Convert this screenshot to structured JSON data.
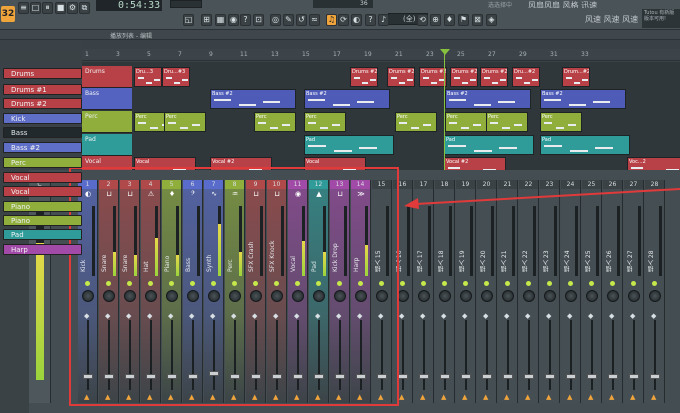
{
  "toolbar": {
    "logo": "32",
    "time": "0:54:33",
    "pattern_name": "Bass",
    "pattern_num": "36",
    "snap": "(全)",
    "top_info": "选选择中",
    "top_info2": "风扇风扇 风格 迅速",
    "big_eq": "风速 风速 风速",
    "tip": "Tutou 有新版\n版本可用!",
    "buttons": [
      "≡",
      "□",
      "⏸",
      "■",
      "⚙",
      "⧉",
      "◱",
      "⊞",
      "▦",
      "◉",
      "?",
      "⊡",
      "◎",
      "✎",
      "↺",
      "≈",
      "♫",
      "⟳",
      "◐",
      "?",
      "♪",
      "⟲",
      "⊕",
      "♦",
      "⚑",
      "⊠",
      "◈"
    ]
  },
  "playlist": {
    "title": "播放列表 - 编辑",
    "ruler": [
      "1",
      "3",
      "5",
      "7",
      "9",
      "11",
      "13",
      "15",
      "17",
      "19",
      "21",
      "23",
      "25",
      "27",
      "29",
      "31",
      "33"
    ],
    "tracks": [
      {
        "name": "Drums",
        "color": "#b84147"
      },
      {
        "name": "Bass",
        "color": "#5463c0"
      },
      {
        "name": "Perc",
        "color": "#8fae3b"
      },
      {
        "name": "Pad",
        "color": "#2f9c9a"
      },
      {
        "name": "Vocal",
        "color": "#b84147"
      }
    ],
    "clips": {
      "drums": [
        "Dru...3",
        "Dru...#3",
        "Drums #2",
        "Drums #2",
        "Drums #2",
        "Drums #2",
        "Drums #2",
        "Dru...#2",
        "Drum...#2"
      ],
      "bass": [
        "Bass #2",
        "Bass #2",
        "Bass #2",
        "Bass #2"
      ],
      "perc": [
        "Perc",
        "Perc",
        "Perc",
        "Perc",
        "Perc",
        "Perc",
        "Perc",
        "Perc"
      ],
      "pad": [
        "Pad",
        "Pad",
        "Pad"
      ],
      "vocal": [
        "Vocal",
        "Vocal #2",
        "Vocal",
        "Vocal #2",
        "Voc...2"
      ]
    }
  },
  "picker": {
    "items": [
      {
        "label": "Drums",
        "color": "#b84147"
      },
      {
        "label": "Drums #1",
        "color": "#b84147"
      },
      {
        "label": "Drums #2",
        "color": "#b84147"
      },
      {
        "label": "Kick",
        "color": "#5f6fc8"
      },
      {
        "label": "Bass",
        "color": "#5f6fc8"
      },
      {
        "label": "Bass #2",
        "color": "#5f6fc8"
      },
      {
        "label": "Perc",
        "color": "#8fae3b"
      },
      {
        "label": "Vocal",
        "color": "#b84147"
      },
      {
        "label": "Vocal",
        "color": "#b84147"
      },
      {
        "label": "Piano",
        "color": "#8fae3b"
      },
      {
        "label": "Piano",
        "color": "#8fae3b"
      },
      {
        "label": "Pad",
        "color": "#2f9c9a"
      },
      {
        "label": "Harp",
        "color": "#a24aa8"
      }
    ]
  },
  "mixer": {
    "master_label": "C",
    "master_level": 0.78,
    "header_num_m": "M",
    "strips": [
      {
        "num": "1",
        "label": "Kick",
        "color": "#5a6ccb",
        "icon": "◐",
        "level": 0.0,
        "fader": 0.2
      },
      {
        "num": "2",
        "label": "Snare",
        "color": "#b04a4a",
        "icon": "⊔",
        "level": 0.35,
        "fader": 0.2
      },
      {
        "num": "3",
        "label": "Snare",
        "color": "#b04a4a",
        "icon": "⊔",
        "level": 0.3,
        "fader": 0.2
      },
      {
        "num": "4",
        "label": "Hat",
        "color": "#b04a4a",
        "icon": "⚠",
        "level": 0.55,
        "fader": 0.2
      },
      {
        "num": "5",
        "label": "Piano",
        "color": "#8fae3b",
        "icon": "♦",
        "level": 0.3,
        "fader": 0.2
      },
      {
        "num": "6",
        "label": "Bass",
        "color": "#5a6ccb",
        "icon": "𝄢",
        "level": 0.0,
        "fader": 0.2
      },
      {
        "num": "7",
        "label": "Synth",
        "color": "#5a6ccb",
        "icon": "∿",
        "level": 0.75,
        "fader": 0.25
      },
      {
        "num": "8",
        "label": "Perc",
        "color": "#8fae3b",
        "icon": "♒",
        "level": 0.35,
        "fader": 0.2
      },
      {
        "num": "9",
        "label": "SFX Crash",
        "color": "#b04a4a",
        "icon": "⊔",
        "level": 0.0,
        "fader": 0.2
      },
      {
        "num": "10",
        "label": "SFX Knock",
        "color": "#b04a4a",
        "icon": "⊔",
        "level": 0.0,
        "fader": 0.2
      },
      {
        "num": "11",
        "label": "Vocal",
        "color": "#a24aa8",
        "icon": "◉",
        "level": 0.5,
        "fader": 0.2
      },
      {
        "num": "12",
        "label": "Pad",
        "color": "#2f9c9a",
        "icon": "▲",
        "level": 0.35,
        "fader": 0.2
      },
      {
        "num": "13",
        "label": "Kick Drop",
        "color": "#a24aa8",
        "icon": "⊔",
        "level": 0.0,
        "fader": 0.2
      },
      {
        "num": "14",
        "label": "Harp",
        "color": "#a24aa8",
        "icon": "≫",
        "level": 0.45,
        "fader": 0.2
      },
      {
        "num": "15",
        "label": "插入 15",
        "color": "#444d52",
        "icon": "",
        "level": 0.0,
        "fader": 0.2
      },
      {
        "num": "16",
        "label": "插入 16",
        "color": "#444d52",
        "icon": "",
        "level": 0.0,
        "fader": 0.2
      },
      {
        "num": "17",
        "label": "插入 17",
        "color": "#444d52",
        "icon": "",
        "level": 0.0,
        "fader": 0.2
      },
      {
        "num": "18",
        "label": "插入 18",
        "color": "#444d52",
        "icon": "",
        "level": 0.0,
        "fader": 0.2
      },
      {
        "num": "19",
        "label": "插入 19",
        "color": "#444d52",
        "icon": "",
        "level": 0.0,
        "fader": 0.2
      },
      {
        "num": "20",
        "label": "插入 20",
        "color": "#444d52",
        "icon": "",
        "level": 0.0,
        "fader": 0.2
      },
      {
        "num": "21",
        "label": "插入 21",
        "color": "#444d52",
        "icon": "",
        "level": 0.0,
        "fader": 0.2
      },
      {
        "num": "22",
        "label": "插入 22",
        "color": "#444d52",
        "icon": "",
        "level": 0.0,
        "fader": 0.2
      },
      {
        "num": "23",
        "label": "插入 23",
        "color": "#444d52",
        "icon": "",
        "level": 0.0,
        "fader": 0.2
      },
      {
        "num": "24",
        "label": "插入 24",
        "color": "#444d52",
        "icon": "",
        "level": 0.0,
        "fader": 0.2
      },
      {
        "num": "25",
        "label": "插入 25",
        "color": "#444d52",
        "icon": "",
        "level": 0.0,
        "fader": 0.2
      },
      {
        "num": "26",
        "label": "插入 26",
        "color": "#444d52",
        "icon": "",
        "level": 0.0,
        "fader": 0.2
      },
      {
        "num": "27",
        "label": "插入 27",
        "color": "#444d52",
        "icon": "",
        "level": 0.0,
        "fader": 0.2
      },
      {
        "num": "28",
        "label": "插入 28",
        "color": "#444d52",
        "icon": "",
        "level": 0.0,
        "fader": 0.2
      }
    ]
  }
}
